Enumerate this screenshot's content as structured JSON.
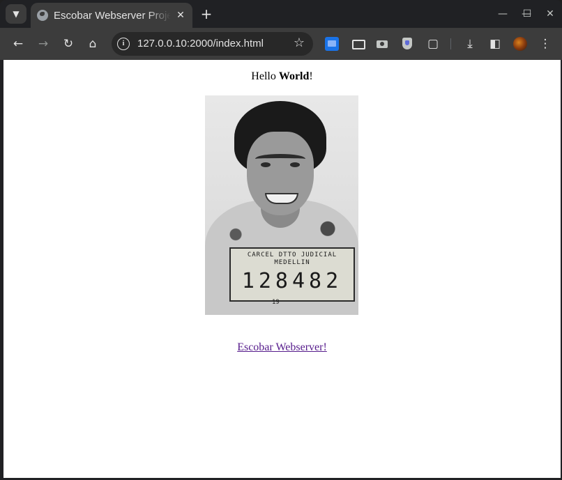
{
  "browser": {
    "tab_title": "Escobar Webserver Project",
    "url": "127.0.0.10:2000/index.html"
  },
  "page": {
    "greeting_prefix": "Hello ",
    "greeting_bold": "World",
    "greeting_suffix": "!",
    "placard_line1": "CARCEL DTTO JUDICIAL",
    "placard_line2": "MEDELLIN",
    "placard_number": "128482",
    "placard_year": "19",
    "link_text": "Escobar Webserver!"
  },
  "icons": {
    "tab_search": "chevron-down-icon",
    "favicon": "globe-icon",
    "back": "back-arrow-icon",
    "forward": "forward-arrow-icon",
    "reload": "reload-icon",
    "home": "home-icon",
    "site_info": "info-icon",
    "bookmark": "star-icon",
    "download": "download-icon",
    "side_panel": "side-panel-icon",
    "menu": "kebab-menu-icon"
  },
  "colors": {
    "chrome_dark": "#202124",
    "toolbar": "#3c3c3c",
    "visited_link": "#551a8b"
  }
}
